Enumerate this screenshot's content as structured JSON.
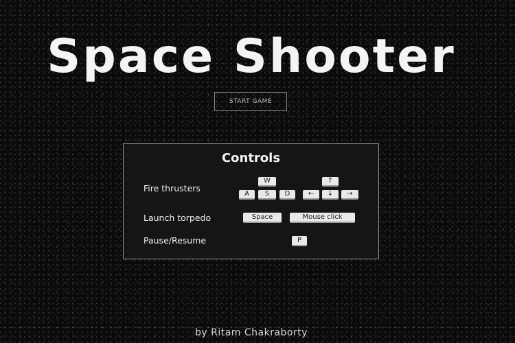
{
  "game": {
    "title": "Space Shooter",
    "start_button": "START GAME",
    "credit": "by Ritam Chakraborty"
  },
  "controls": {
    "heading": "Controls",
    "fire_thrusters": {
      "label": "Fire thrusters",
      "wasd": [
        "W",
        "A",
        "S",
        "D"
      ],
      "arrows": [
        "↑",
        "←",
        "↓",
        "→"
      ]
    },
    "launch_torpedo": {
      "label": "Launch torpedo",
      "keys": [
        "Space",
        "Mouse click"
      ]
    },
    "pause_resume": {
      "label": "Pause/Resume",
      "keys": [
        "P"
      ]
    }
  },
  "colors": {
    "background": "#0b0b0b",
    "text": "#f4f4f4",
    "key_cap": "#e9e9e9",
    "panel": "#151515"
  }
}
